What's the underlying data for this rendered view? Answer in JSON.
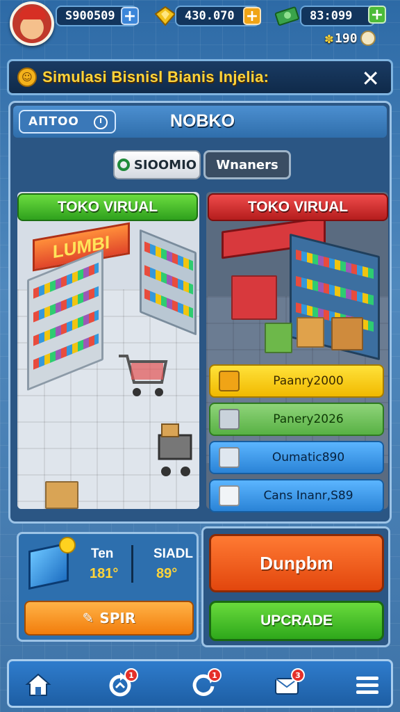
{
  "header": {
    "cash": "S900509",
    "gold": "430.070",
    "bills": "83:099",
    "gems": "190"
  },
  "banner": {
    "title": "Simulasi Bisnisl Bianis Injelia:",
    "close_glyph": "✕"
  },
  "panel": {
    "code": "ΑΠΤΟΟ",
    "title": "NOBKO",
    "tabs": [
      {
        "label": "SIOOMIO",
        "active": true
      },
      {
        "label": "Wnaners",
        "active": false
      }
    ],
    "stores": [
      {
        "tag": "TOKO VIRUAL",
        "sign": "LUMBI",
        "color": "#2fa11d"
      },
      {
        "tag": "TOKO VIRUAL",
        "color": "#b51d1d"
      }
    ],
    "price_items": [
      {
        "label": "Paanry2000",
        "icon": "box-icon"
      },
      {
        "label": "Panery2026",
        "icon": "register-icon"
      },
      {
        "label": "Oumatic890",
        "icon": "crate-icon"
      },
      {
        "label": "Cans Inanr,S89",
        "icon": "cube-icon"
      }
    ]
  },
  "stats": {
    "items": [
      {
        "label": "Ten",
        "value": "181°"
      },
      {
        "label": "SIADL",
        "value": "89°"
      }
    ],
    "spin_label": "SPIR",
    "spin_glyph": "✎"
  },
  "actions": {
    "primary": "Dunpbm",
    "upgrade": "UPCRADE"
  },
  "nav": {
    "items": [
      {
        "name": "home",
        "badge": ""
      },
      {
        "name": "refresh",
        "badge": "1"
      },
      {
        "name": "reload",
        "badge": "1"
      },
      {
        "name": "mail",
        "badge": "3"
      },
      {
        "name": "menu",
        "badge": ""
      }
    ]
  },
  "colors": {
    "accent_yellow": "#ffd43a",
    "panel_blue": "#2b5684",
    "green": "#2fa11d",
    "red": "#b51d1d",
    "orange": "#e2460d"
  }
}
